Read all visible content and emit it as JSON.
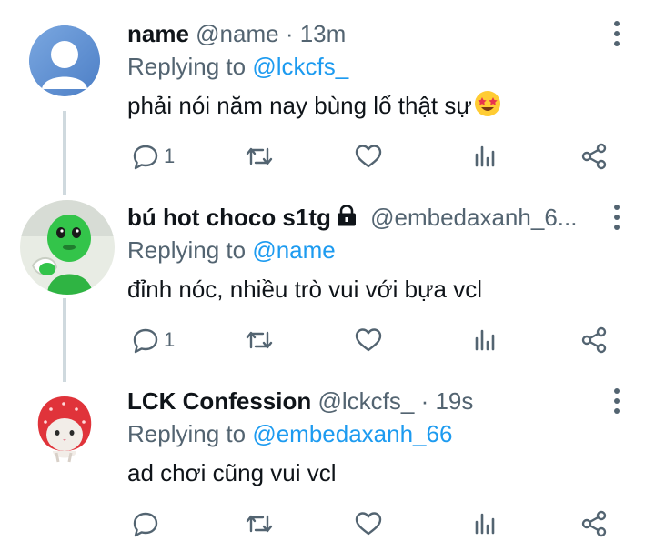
{
  "tweets": [
    {
      "name": "name",
      "handle": "@name",
      "time": "· 13m",
      "replying_label": "Replying to",
      "replying_to": "@lckcfs_",
      "text": "phải nói năm nay bùng lổ thật sự",
      "emoji": "star-struck-emoji",
      "reply_count": "1",
      "avatar": "default-avatar",
      "protected": false
    },
    {
      "name": "bú hot choco s1tg",
      "handle": "@embedaxanh_6...",
      "time": "",
      "replying_label": "Replying to",
      "replying_to": "@name",
      "text": "đỉnh nóc, nhiều trò vui với bựa vcl",
      "reply_count": "1",
      "avatar": "green-character-avatar",
      "protected": true
    },
    {
      "name": "LCK Confession",
      "handle": "@lckcfs_",
      "time": "· 19s",
      "replying_label": "Replying to",
      "replying_to": "@embedaxanh_66",
      "text": "ad chơi cũng vui vcl",
      "reply_count": "",
      "avatar": "strawberry-cat-avatar",
      "protected": false
    }
  ],
  "colors": {
    "text": "#0f1419",
    "secondary": "#536471",
    "mention": "#1d9bf0",
    "thread_line": "#cfd9de"
  }
}
